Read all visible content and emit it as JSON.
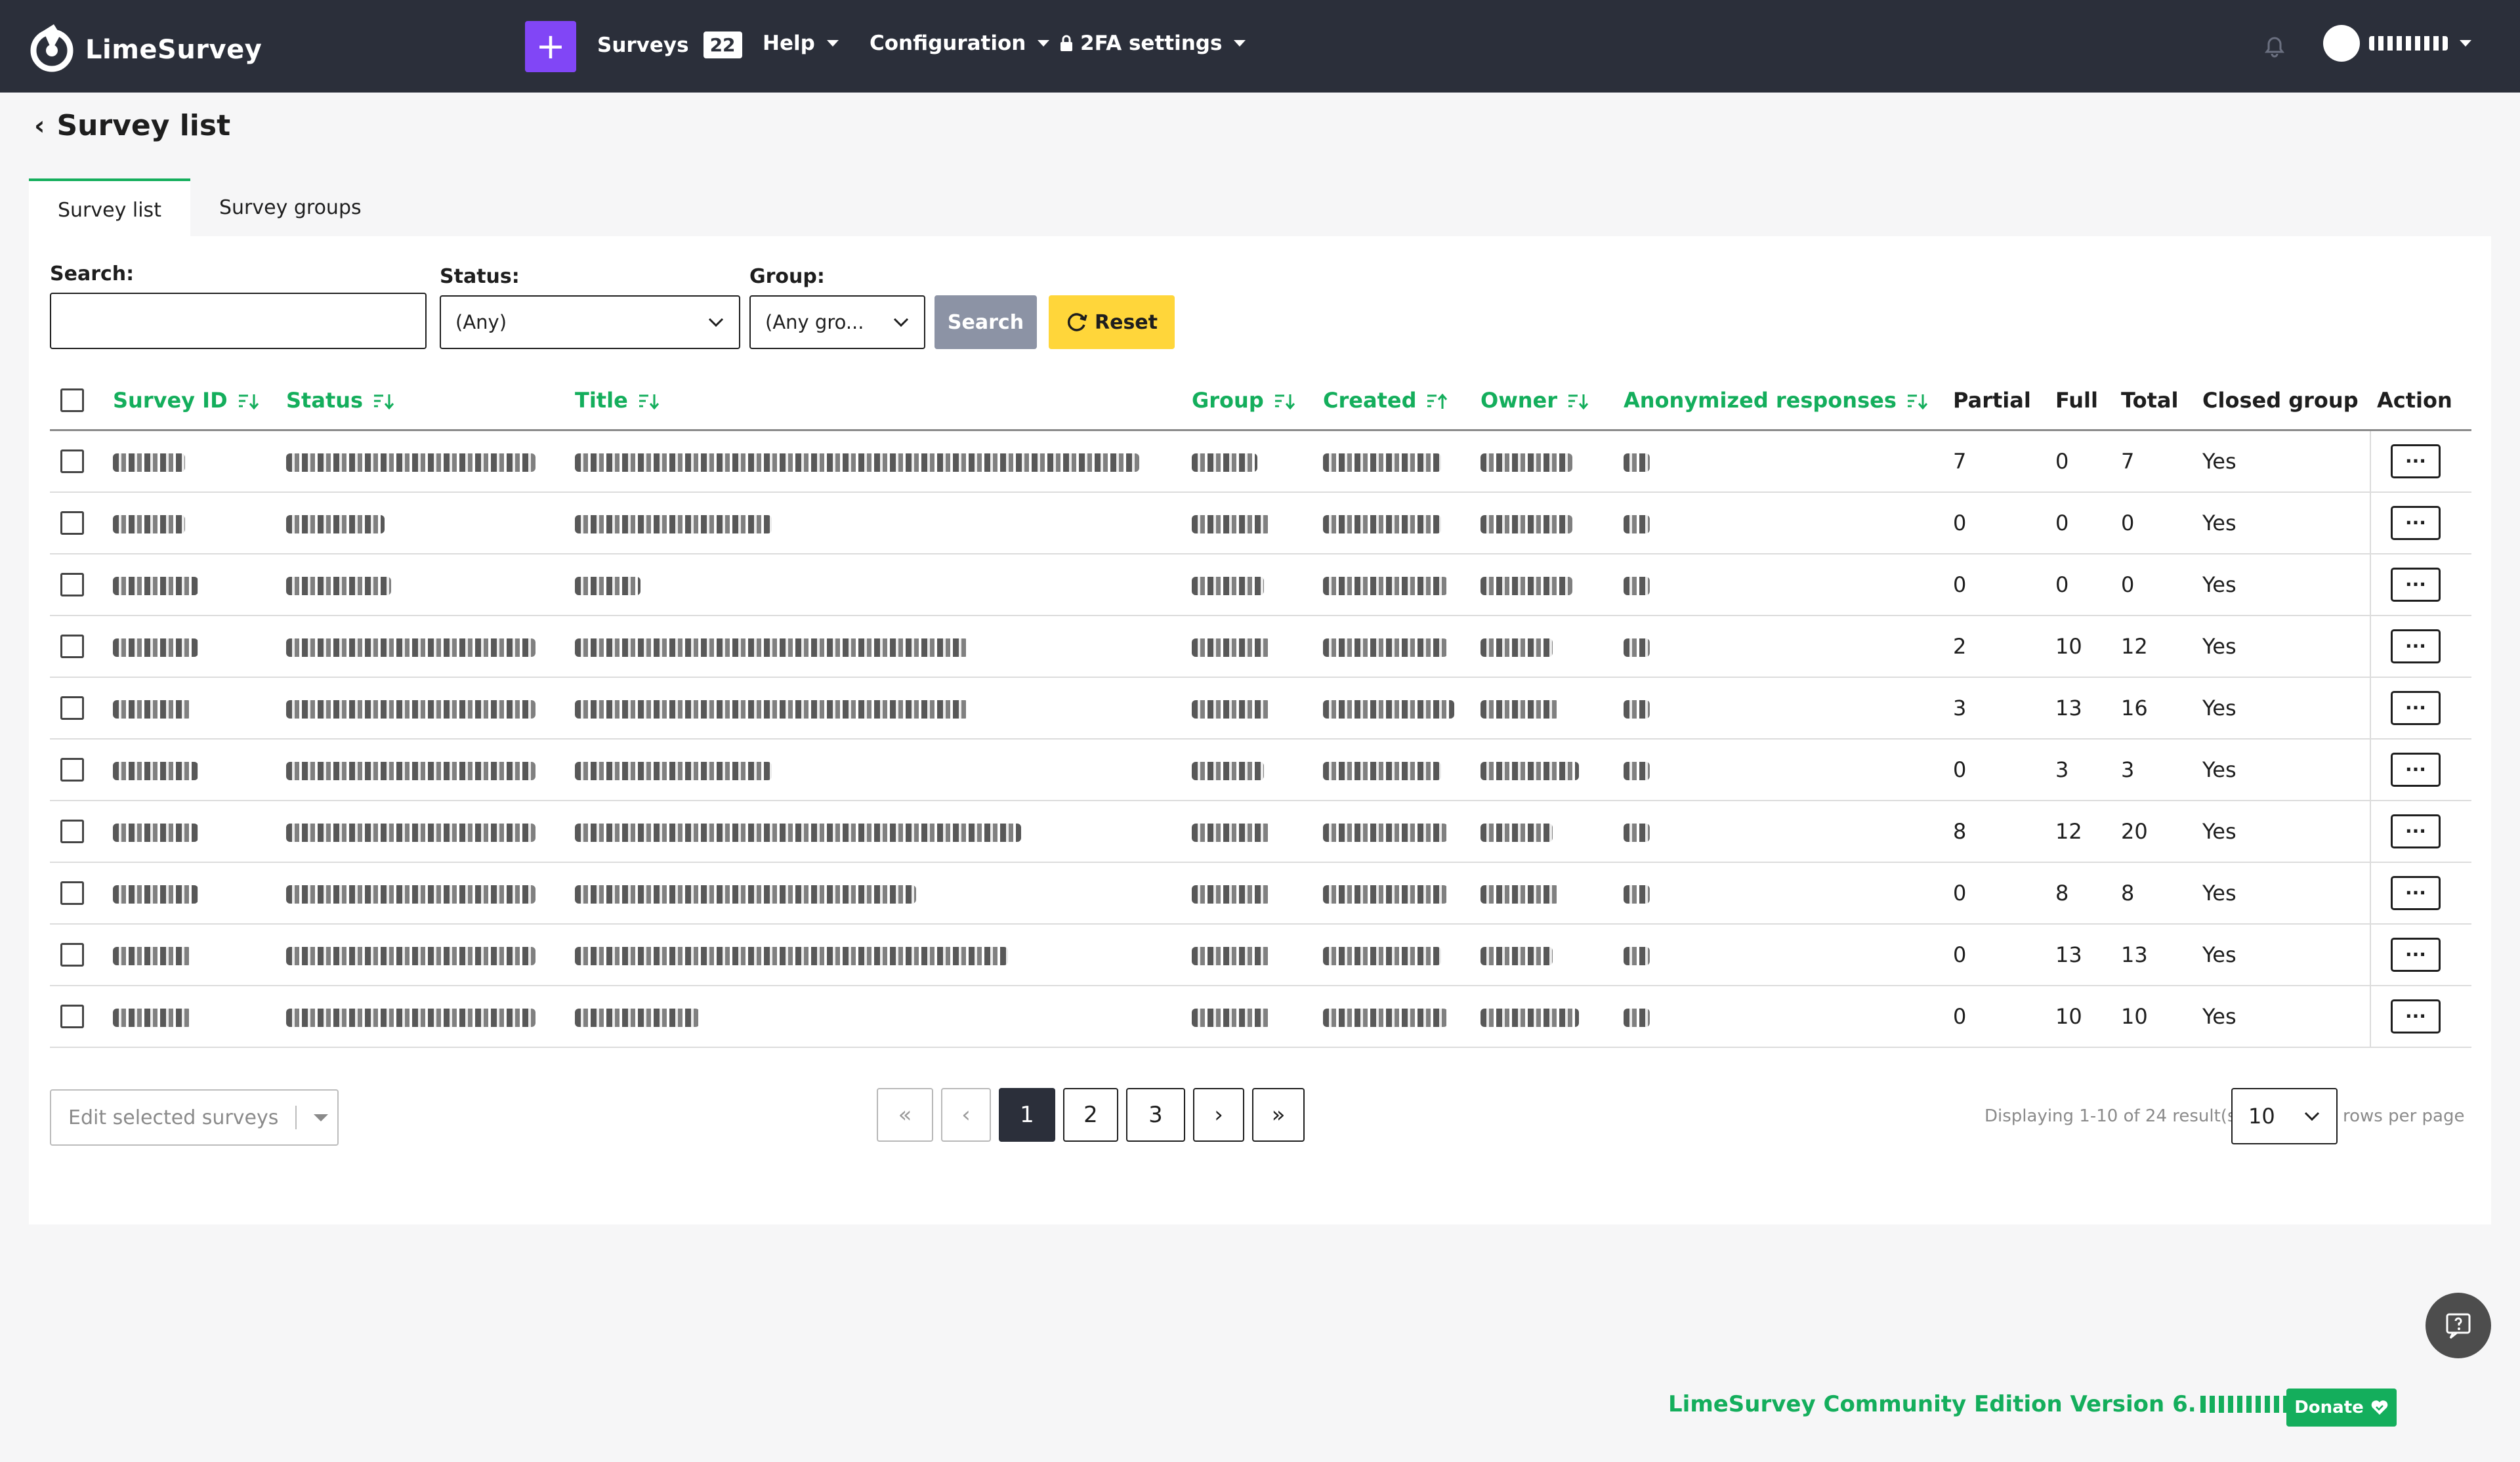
{
  "app": {
    "name": "LimeSurvey",
    "surveys_label": "Surveys",
    "surveys_count": "22",
    "menu": [
      "Help",
      "Configuration",
      "2FA settings"
    ]
  },
  "page": {
    "back_icon": "chevron-left-icon",
    "title": "Survey list"
  },
  "tabs": [
    {
      "label": "Survey list",
      "active": true
    },
    {
      "label": "Survey groups",
      "active": false
    }
  ],
  "filters": {
    "search_label": "Search:",
    "search_value": "",
    "status_label": "Status:",
    "status_value": "(Any)",
    "group_label": "Group:",
    "group_value": "(Any gro...",
    "search_button": "Search",
    "reset_button": "Reset"
  },
  "table": {
    "columns": [
      "Survey ID",
      "Status",
      "Title",
      "Group",
      "Created",
      "Owner",
      "Anonymized responses",
      "Partial",
      "Full",
      "Total",
      "Closed group",
      "Action"
    ],
    "rows": [
      {
        "partial": "7",
        "full": "0",
        "total": "7",
        "closed_group": "Yes"
      },
      {
        "partial": "0",
        "full": "0",
        "total": "0",
        "closed_group": "Yes"
      },
      {
        "partial": "0",
        "full": "0",
        "total": "0",
        "closed_group": "Yes"
      },
      {
        "partial": "2",
        "full": "10",
        "total": "12",
        "closed_group": "Yes"
      },
      {
        "partial": "3",
        "full": "13",
        "total": "16",
        "closed_group": "Yes"
      },
      {
        "partial": "0",
        "full": "3",
        "total": "3",
        "closed_group": "Yes"
      },
      {
        "partial": "8",
        "full": "12",
        "total": "20",
        "closed_group": "Yes"
      },
      {
        "partial": "0",
        "full": "8",
        "total": "8",
        "closed_group": "Yes"
      },
      {
        "partial": "0",
        "full": "13",
        "total": "13",
        "closed_group": "Yes"
      },
      {
        "partial": "0",
        "full": "10",
        "total": "10",
        "closed_group": "Yes"
      }
    ],
    "action_label": "···"
  },
  "bulk": {
    "label": "Edit selected surveys"
  },
  "pagination": {
    "first": "«",
    "prev": "‹",
    "pages": [
      "1",
      "2",
      "3"
    ],
    "current": "1",
    "next": "›",
    "last": "»",
    "summary": "Displaying 1-10 of 24 result(s).",
    "rows_value": "10",
    "rows_label": "rows per page"
  },
  "footer": {
    "version": "LimeSurvey Community Edition Version 6.",
    "donate": "Donate"
  },
  "colors": {
    "navbar": "#2b2f3a",
    "accent_purple": "#8146f6",
    "brand_green": "#14ae5c",
    "reset_yellow": "#ffd63a",
    "search_gray": "#8c93a5"
  }
}
